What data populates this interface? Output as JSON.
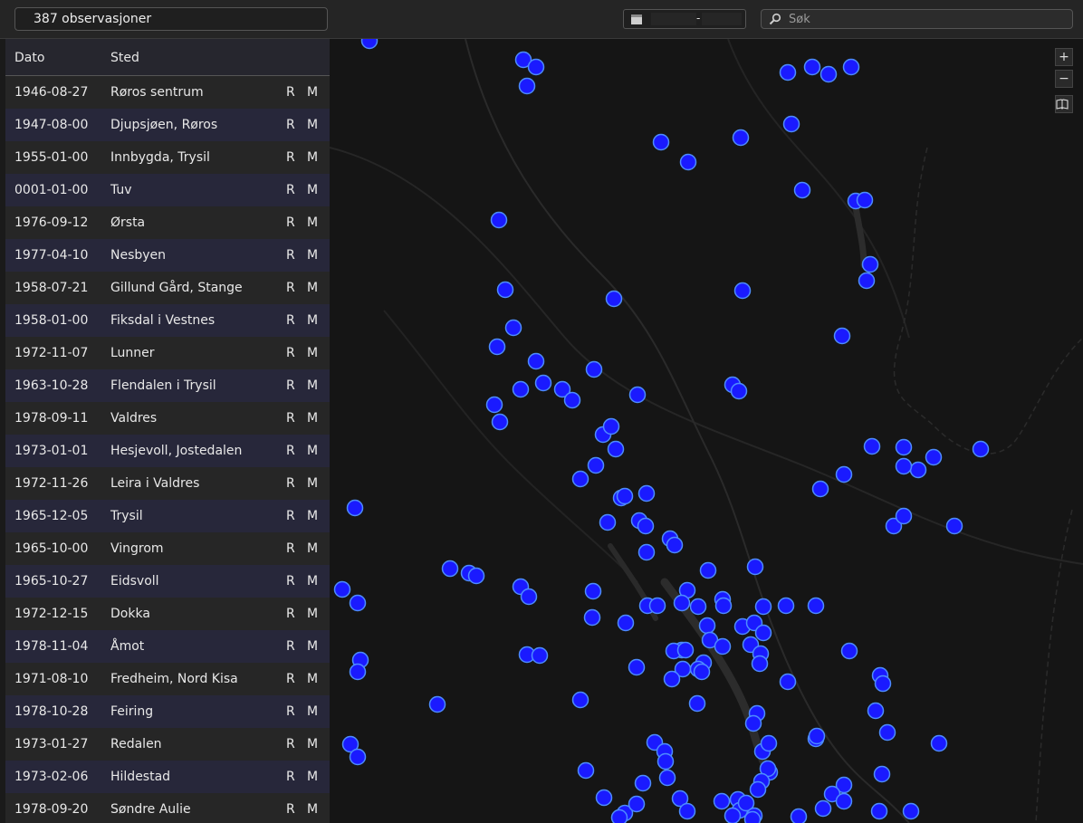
{
  "header": {
    "count_label": "387 observasjoner",
    "date_from": "",
    "date_to": "",
    "date_separator": "-",
    "search_placeholder": "Søk"
  },
  "list": {
    "columns": {
      "date": "Dato",
      "place": "Sted"
    },
    "action_r": "R",
    "action_m": "M",
    "rows": [
      {
        "date": "1946-08-27",
        "place": "Røros sentrum"
      },
      {
        "date": "1947-08-00",
        "place": "Djupsjøen, Røros"
      },
      {
        "date": "1955-01-00",
        "place": "Innbygda, Trysil"
      },
      {
        "date": "0001-01-00",
        "place": "Tuv"
      },
      {
        "date": "1976-09-12",
        "place": "Ørsta"
      },
      {
        "date": "1977-04-10",
        "place": "Nesbyen"
      },
      {
        "date": "1958-07-21",
        "place": "Gillund Gård, Stange"
      },
      {
        "date": "1958-01-00",
        "place": "Fiksdal i Vestnes"
      },
      {
        "date": "1972-11-07",
        "place": "Lunner"
      },
      {
        "date": "1963-10-28",
        "place": "Flendalen i Trysil"
      },
      {
        "date": "1978-09-11",
        "place": "Valdres"
      },
      {
        "date": "1973-01-01",
        "place": "Hesjevoll, Jostedalen"
      },
      {
        "date": "1972-11-26",
        "place": "Leira i Valdres"
      },
      {
        "date": "1965-12-05",
        "place": "Trysil"
      },
      {
        "date": "1965-10-00",
        "place": "Vingrom"
      },
      {
        "date": "1965-10-27",
        "place": "Eidsvoll"
      },
      {
        "date": "1972-12-15",
        "place": "Dokka"
      },
      {
        "date": "1978-11-04",
        "place": "Åmot"
      },
      {
        "date": "1971-08-10",
        "place": "Fredheim, Nord Kisa"
      },
      {
        "date": "1978-10-28",
        "place": "Feiring"
      },
      {
        "date": "1973-01-27",
        "place": "Redalen"
      },
      {
        "date": "1973-02-06",
        "place": "Hildestad"
      },
      {
        "date": "1978-09-20",
        "place": "Søndre Aulie"
      }
    ]
  },
  "map": {
    "zoom_in_label": "+",
    "zoom_out_label": "−",
    "layers_icon": "map-book-icon",
    "marker_fill": "#1a1aff",
    "marker_stroke": "#4d8cff",
    "background": "#151515"
  }
}
